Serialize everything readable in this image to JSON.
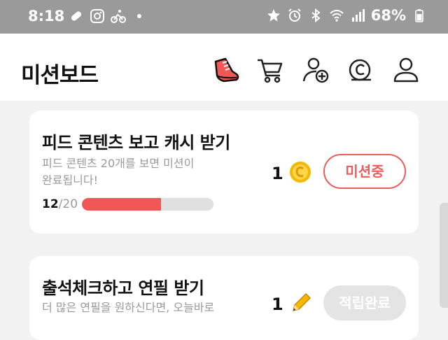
{
  "status_bar": {
    "time": "8:18",
    "battery_percent": "68%",
    "left_icons": [
      "pill-icon",
      "instagram-icon",
      "cyclist-icon",
      "dot-icon"
    ],
    "right_icons": [
      "star-icon",
      "alarm-icon",
      "bluetooth-icon",
      "wifi-icon",
      "signal-icon",
      "battery-icon"
    ]
  },
  "header": {
    "title": "미션보드",
    "icons": [
      "shoe-icon",
      "cart-icon",
      "add-friend-icon",
      "coin-icon",
      "profile-icon"
    ]
  },
  "missions": [
    {
      "title": "피드 콘텐츠 보고 캐시 받기",
      "desc_line1": "피드 콘텐츠 20개를 보면 미션이",
      "desc_line2": "완료됩니다!",
      "progress_current": "12",
      "progress_sep": "/",
      "progress_total": "20",
      "progress_fraction": 0.6,
      "reward_amount": "1",
      "reward_icon": "coin-icon",
      "button_label": "미션중"
    },
    {
      "title": "출석체크하고 연필 받기",
      "desc_line1": "더 많은 연필을 원하신다면, 오늘바로",
      "reward_amount": "1",
      "reward_icon": "pencil-icon",
      "button_label": "적립완료"
    }
  ],
  "colors": {
    "accent": "#ef5a5a",
    "progress_fill": "#f25757",
    "status_bar": "#9a9a9a",
    "coin": "#f5b800"
  }
}
